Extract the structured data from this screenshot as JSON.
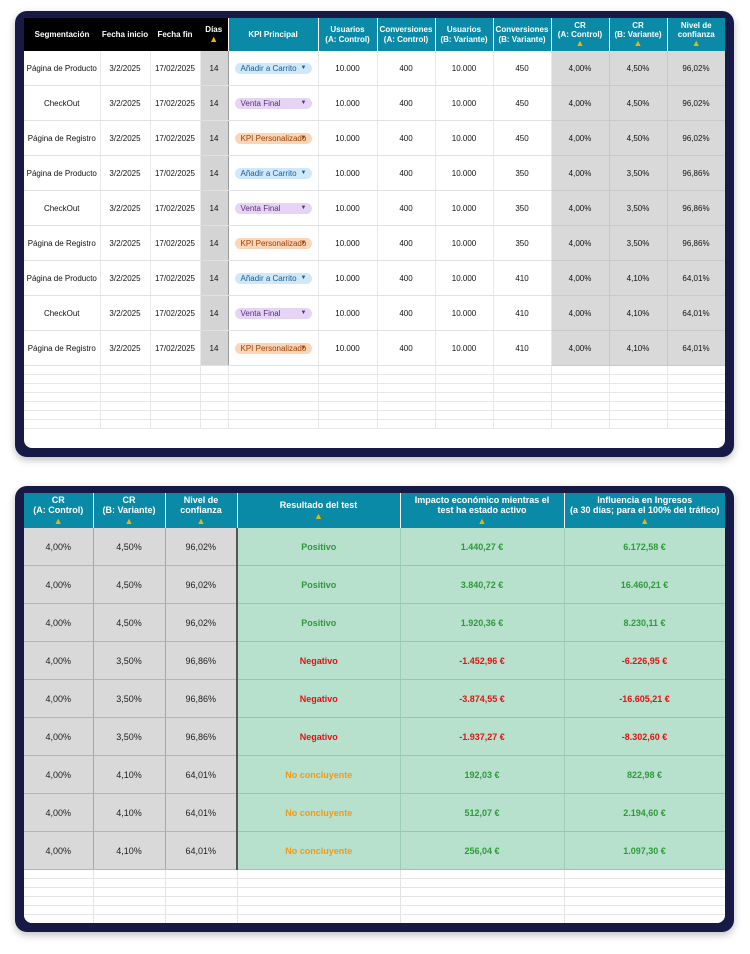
{
  "table1": {
    "headers": {
      "segmentacion": "Segmentación",
      "fecha_inicio": "Fecha inicio",
      "fecha_fin": "Fecha fin",
      "dias": "Días",
      "kpi": "KPI Principal",
      "usuarios_a_1": "Usuarios",
      "usuarios_a_2": "(A: Control)",
      "conv_a_1": "Conversiones",
      "conv_a_2": "(A: Control)",
      "usuarios_b_1": "Usuarios",
      "usuarios_b_2": "(B: Variante)",
      "conv_b_1": "Conversiones",
      "conv_b_2": "(B: Variante)",
      "cr_a_1": "CR",
      "cr_a_2": "(A: Control)",
      "cr_b_1": "CR",
      "cr_b_2": "(B: Variante)",
      "nivel_1": "Nivel de",
      "nivel_2": "confianza",
      "warning_symbol": "▲"
    },
    "rows": [
      {
        "seg": "Página de Producto",
        "inicio": "3/2/2025",
        "fin": "17/02/2025",
        "dias": "14",
        "kpi": "Añadir a Carrito",
        "kpi_color": "blue",
        "ua": "10.000",
        "ca": "400",
        "ub": "10.000",
        "cb": "450",
        "cra": "4,00%",
        "crb": "4,50%",
        "nivel": "96,02%"
      },
      {
        "seg": "CheckOut",
        "inicio": "3/2/2025",
        "fin": "17/02/2025",
        "dias": "14",
        "kpi": "Venta Final",
        "kpi_color": "purple",
        "ua": "10.000",
        "ca": "400",
        "ub": "10.000",
        "cb": "450",
        "cra": "4,00%",
        "crb": "4,50%",
        "nivel": "96,02%"
      },
      {
        "seg": "Página de Registro",
        "inicio": "3/2/2025",
        "fin": "17/02/2025",
        "dias": "14",
        "kpi": "KPI Personalizado",
        "kpi_color": "orange",
        "ua": "10.000",
        "ca": "400",
        "ub": "10.000",
        "cb": "450",
        "cra": "4,00%",
        "crb": "4,50%",
        "nivel": "96,02%"
      },
      {
        "seg": "Página de Producto",
        "inicio": "3/2/2025",
        "fin": "17/02/2025",
        "dias": "14",
        "kpi": "Añadir a Carrito",
        "kpi_color": "blue",
        "ua": "10.000",
        "ca": "400",
        "ub": "10.000",
        "cb": "350",
        "cra": "4,00%",
        "crb": "3,50%",
        "nivel": "96,86%"
      },
      {
        "seg": "CheckOut",
        "inicio": "3/2/2025",
        "fin": "17/02/2025",
        "dias": "14",
        "kpi": "Venta Final",
        "kpi_color": "purple",
        "ua": "10.000",
        "ca": "400",
        "ub": "10.000",
        "cb": "350",
        "cra": "4,00%",
        "crb": "3,50%",
        "nivel": "96,86%"
      },
      {
        "seg": "Página de Registro",
        "inicio": "3/2/2025",
        "fin": "17/02/2025",
        "dias": "14",
        "kpi": "KPI Personalizado",
        "kpi_color": "orange",
        "ua": "10.000",
        "ca": "400",
        "ub": "10.000",
        "cb": "350",
        "cra": "4,00%",
        "crb": "3,50%",
        "nivel": "96,86%"
      },
      {
        "seg": "Página de Producto",
        "inicio": "3/2/2025",
        "fin": "17/02/2025",
        "dias": "14",
        "kpi": "Añadir a Carrito",
        "kpi_color": "blue",
        "ua": "10.000",
        "ca": "400",
        "ub": "10.000",
        "cb": "410",
        "cra": "4,00%",
        "crb": "4,10%",
        "nivel": "64,01%"
      },
      {
        "seg": "CheckOut",
        "inicio": "3/2/2025",
        "fin": "17/02/2025",
        "dias": "14",
        "kpi": "Venta Final",
        "kpi_color": "purple",
        "ua": "10.000",
        "ca": "400",
        "ub": "10.000",
        "cb": "410",
        "cra": "4,00%",
        "crb": "4,10%",
        "nivel": "64,01%"
      },
      {
        "seg": "Página de Registro",
        "inicio": "3/2/2025",
        "fin": "17/02/2025",
        "dias": "14",
        "kpi": "KPI Personalizado",
        "kpi_color": "orange",
        "ua": "10.000",
        "ca": "400",
        "ub": "10.000",
        "cb": "410",
        "cra": "4,00%",
        "crb": "4,10%",
        "nivel": "64,01%"
      }
    ],
    "empty_rows": 7
  },
  "table2": {
    "headers": {
      "cr_a_1": "CR",
      "cr_a_2": "(A: Control)",
      "cr_b_1": "CR",
      "cr_b_2": "(B: Variante)",
      "nivel_1": "Nivel de",
      "nivel_2": "confianza",
      "resultado": "Resultado del test",
      "impacto_1": "Impacto económico mientras el",
      "impacto_2": "test ha estado activo",
      "influencia_1": "Influencia en Ingresos",
      "influencia_2": "(a 30 días; para el 100% del tráfico)",
      "warning_symbol": "▲"
    },
    "rows": [
      {
        "cra": "4,00%",
        "crb": "4,50%",
        "nivel": "96,02%",
        "resultado": "Positivo",
        "estado": "pos",
        "impacto": "1.440,27 €",
        "influencia": "6.172,58 €"
      },
      {
        "cra": "4,00%",
        "crb": "4,50%",
        "nivel": "96,02%",
        "resultado": "Positivo",
        "estado": "pos",
        "impacto": "3.840,72 €",
        "influencia": "16.460,21 €"
      },
      {
        "cra": "4,00%",
        "crb": "4,50%",
        "nivel": "96,02%",
        "resultado": "Positivo",
        "estado": "pos",
        "impacto": "1.920,36 €",
        "influencia": "8.230,11 €"
      },
      {
        "cra": "4,00%",
        "crb": "3,50%",
        "nivel": "96,86%",
        "resultado": "Negativo",
        "estado": "neg",
        "impacto": "-1.452,96 €",
        "influencia": "-6.226,95 €"
      },
      {
        "cra": "4,00%",
        "crb": "3,50%",
        "nivel": "96,86%",
        "resultado": "Negativo",
        "estado": "neg",
        "impacto": "-3.874,55 €",
        "influencia": "-16.605,21 €"
      },
      {
        "cra": "4,00%",
        "crb": "3,50%",
        "nivel": "96,86%",
        "resultado": "Negativo",
        "estado": "neg",
        "impacto": "-1.937,27 €",
        "influencia": "-8.302,60 €"
      },
      {
        "cra": "4,00%",
        "crb": "4,10%",
        "nivel": "64,01%",
        "resultado": "No concluyente",
        "estado": "inc",
        "impacto": "192,03 €",
        "influencia": "822,98 €"
      },
      {
        "cra": "4,00%",
        "crb": "4,10%",
        "nivel": "64,01%",
        "resultado": "No concluyente",
        "estado": "inc",
        "impacto": "512,07 €",
        "influencia": "2.194,60 €"
      },
      {
        "cra": "4,00%",
        "crb": "4,10%",
        "nivel": "64,01%",
        "resultado": "No concluyente",
        "estado": "inc",
        "impacto": "256,04 €",
        "influencia": "1.097,30 €"
      }
    ],
    "empty_rows": 6
  },
  "colors": {
    "panel_bg": "#161a45",
    "header_teal": "#0b8aa8",
    "header_black": "#000000",
    "result_green_bg": "#b7e0cd",
    "positive": "#2f9a3a",
    "negative": "#e41212",
    "inconclusive": "#f39a12",
    "warning": "#f0b400"
  }
}
